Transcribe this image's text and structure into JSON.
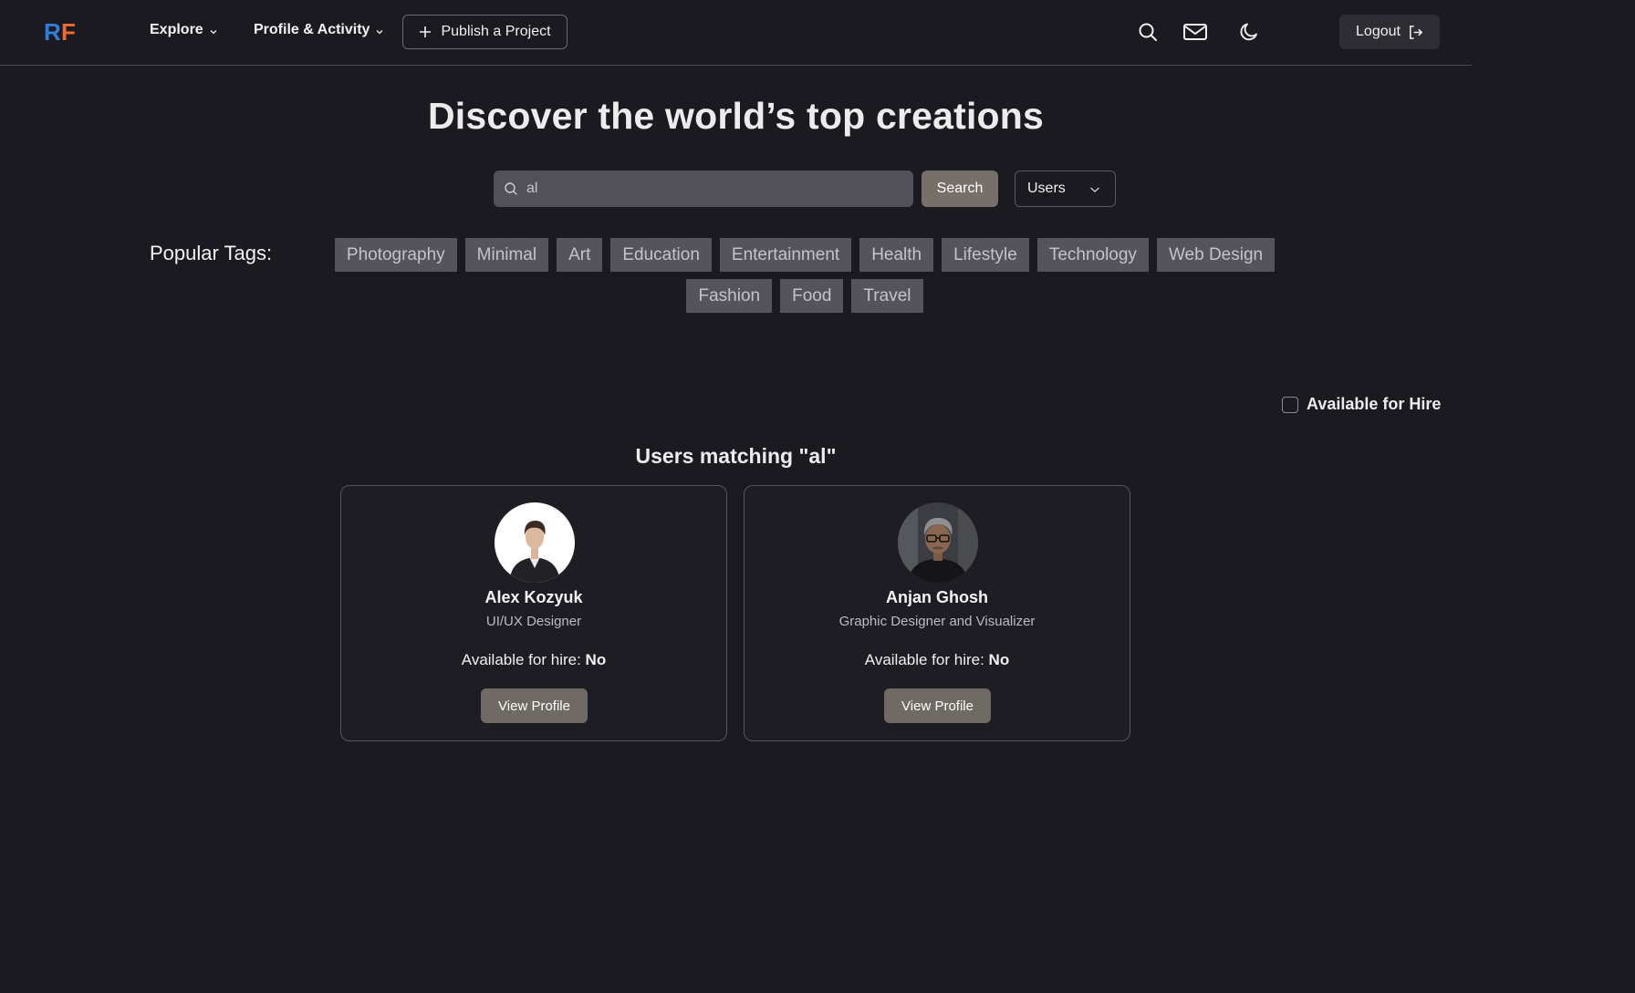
{
  "header": {
    "logo_text": "RF",
    "nav": {
      "explore_label": "Explore",
      "profile_activity_label": "Profile & Activity"
    },
    "publish_label": "Publish a Project",
    "logout_label": "Logout"
  },
  "hero": {
    "title": "Discover the world’s top creations"
  },
  "search": {
    "value": "al",
    "button_label": "Search",
    "type_selected": "Users"
  },
  "tags": {
    "label": "Popular Tags:",
    "items": [
      "Photography",
      "Minimal",
      "Art",
      "Education",
      "Entertainment",
      "Health",
      "Lifestyle",
      "Technology",
      "Web Design",
      "Fashion",
      "Food",
      "Travel"
    ]
  },
  "filter": {
    "available_for_hire_label": "Available for Hire",
    "checked": false
  },
  "results": {
    "heading": "Users matching \"al\"",
    "users": [
      {
        "name": "Alex Kozyuk",
        "role": "UI/UX Designer",
        "hire_label": "Available for hire:",
        "hire_value": "No",
        "button_label": "View Profile"
      },
      {
        "name": "Anjan Ghosh",
        "role": "Graphic Designer and Visualizer",
        "hire_label": "Available for hire:",
        "hire_value": "No",
        "button_label": "View Profile"
      }
    ]
  },
  "colors": {
    "background": "#1b1a20",
    "accent_button": "#77706a",
    "tag_bg": "#55545c",
    "logo_blue": "#2f7fd6",
    "logo_orange": "#f26b2a"
  },
  "icons": {
    "search": "search-icon",
    "mail": "mail-icon",
    "theme": "moon-icon",
    "logout": "logout-icon",
    "publish": "plus-icon"
  }
}
